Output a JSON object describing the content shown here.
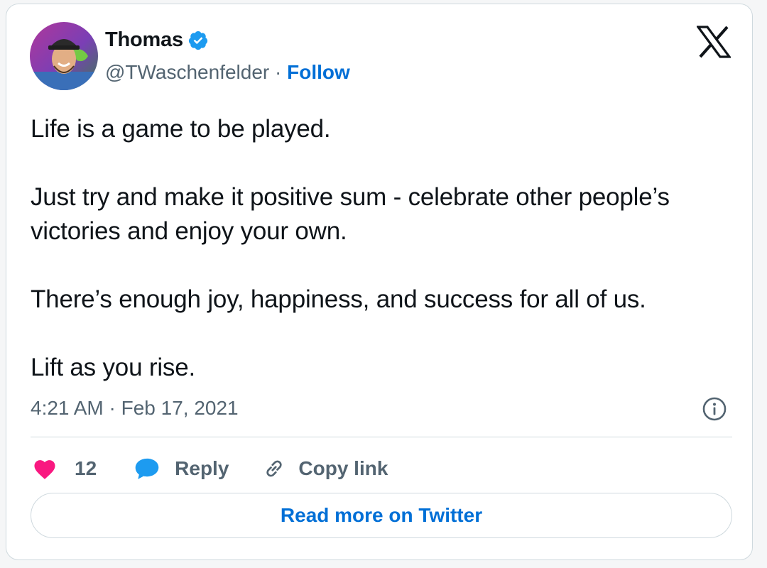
{
  "author": {
    "name": "Thomas",
    "handle": "@TWaschenfelder",
    "separator": " · ",
    "follow_label": "Follow",
    "verified_icon": "verified-badge-icon",
    "avatar_icon": "avatar"
  },
  "tweet": {
    "paragraphs": [
      "Life is a game to be played.",
      "Just try and make it positive sum - celebrate other people’s victories and enjoy your own.",
      "There’s enough joy, happiness, and success for all of us.",
      "Lift as you rise."
    ],
    "timestamp": "4:21 AM · Feb 17, 2021"
  },
  "actions": {
    "like_count": "12",
    "reply_label": "Reply",
    "copy_label": "Copy link"
  },
  "read_more_label": "Read more on Twitter",
  "colors": {
    "accent": "#006fd6",
    "like": "#f91880",
    "reply": "#1d9bf0",
    "muted_text": "#536471",
    "border": "#cfd9de"
  }
}
